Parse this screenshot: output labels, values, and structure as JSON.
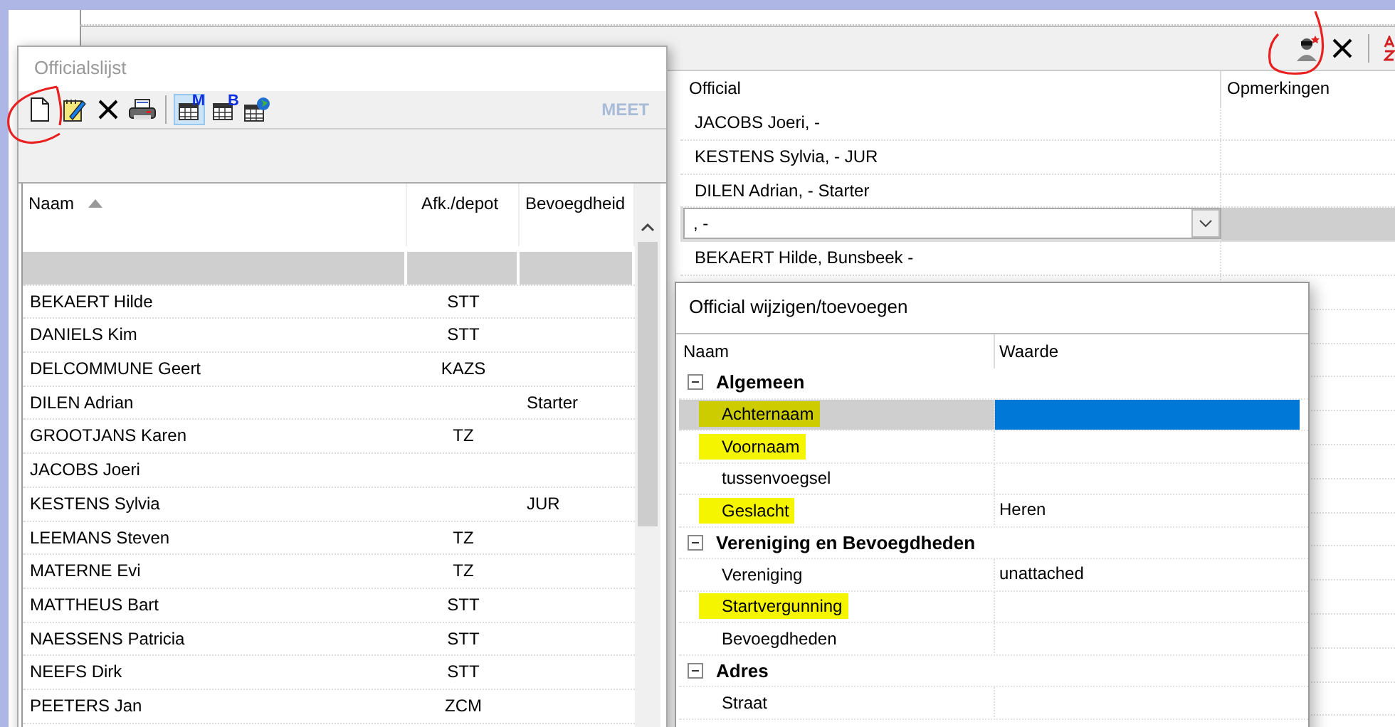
{
  "main_window": {
    "toolbar": [
      {
        "kind": "add-official"
      },
      {
        "kind": "delete"
      },
      {
        "kind": "sort"
      }
    ],
    "grid": {
      "columns": [
        "Official",
        "Opmerkingen"
      ],
      "rows": [
        {
          "kind": "text",
          "official": "JACOBS Joeri,  -",
          "selected": false
        },
        {
          "kind": "text",
          "official": "KESTENS Sylvia,  - JUR",
          "selected": false
        },
        {
          "kind": "text",
          "official": "DILEN Adrian,  - Starter",
          "selected": false
        },
        {
          "kind": "combo",
          "official": ",  -",
          "selected": true
        },
        {
          "kind": "text",
          "official": "BEKAERT Hilde, Bunsbeek -",
          "selected": false
        }
      ]
    }
  },
  "officials_window": {
    "title": "Officialslijst",
    "toolbar": [
      {
        "kind": "new",
        "selected": false
      },
      {
        "kind": "edit",
        "selected": false
      },
      {
        "kind": "delete",
        "selected": false
      },
      {
        "kind": "print",
        "selected": false
      },
      {
        "kind": "separator"
      },
      {
        "kind": "view",
        "badge": "M",
        "selected": true
      },
      {
        "kind": "view",
        "badge": "B",
        "selected": false
      },
      {
        "kind": "globe",
        "selected": false
      }
    ],
    "meet_button": {
      "label": "MEET",
      "disabled": true
    },
    "columns": [
      {
        "label": "Naam",
        "sorted": true
      },
      {
        "label": "Afk./depot",
        "sorted": false
      },
      {
        "label": "Bevoegdheid",
        "sorted": false
      }
    ],
    "new_row": {
      "selected": true
    },
    "rows": [
      {
        "naam": "BEKAERT Hilde",
        "depot": "STT"
      },
      {
        "naam": "DANIELS Kim",
        "depot": "STT"
      },
      {
        "naam": "DELCOMMUNE Geert",
        "depot": "KAZS"
      },
      {
        "naam": "DILEN Adrian",
        "bevoegdheid": "Starter"
      },
      {
        "naam": "GROOTJANS Karen",
        "depot": "TZ"
      },
      {
        "naam": "JACOBS Joeri"
      },
      {
        "naam": "KESTENS Sylvia",
        "bevoegdheid": "JUR"
      },
      {
        "naam": "LEEMANS Steven",
        "depot": "TZ"
      },
      {
        "naam": "MATERNE Evi",
        "depot": "TZ"
      },
      {
        "naam": "MATTHEUS Bart",
        "depot": "STT"
      },
      {
        "naam": "NAESSENS Patricia",
        "depot": "STT"
      },
      {
        "naam": "NEEFS Dirk",
        "depot": "STT"
      },
      {
        "naam": "PEETERS Jan",
        "depot": "ZCM"
      }
    ]
  },
  "edit_dialog": {
    "title": "Official wijzigen/toevoegen",
    "columns": [
      "Naam",
      "Waarde"
    ],
    "categories": [
      {
        "name": "Algemeen",
        "expanded": true,
        "properties": [
          {
            "name": "Achternaam",
            "selected": true,
            "highlighted": true
          },
          {
            "name": "Voornaam",
            "selected": false,
            "highlighted": true
          },
          {
            "name": "tussenvoegsel",
            "selected": false,
            "highlighted": false
          },
          {
            "name": "Geslacht",
            "value": "Heren",
            "selected": false,
            "highlighted": true
          }
        ]
      },
      {
        "name": "Vereniging en Bevoegdheden",
        "expanded": true,
        "properties": [
          {
            "name": "Vereniging",
            "value": "unattached",
            "selected": false,
            "highlighted": false
          },
          {
            "name": "Startvergunning",
            "selected": false,
            "highlighted": true
          },
          {
            "name": "Bevoegdheden",
            "selected": false,
            "highlighted": false
          }
        ]
      },
      {
        "name": "Adres",
        "expanded": true,
        "properties": [
          {
            "name": "Straat",
            "selected": false,
            "highlighted": false
          }
        ]
      }
    ]
  }
}
